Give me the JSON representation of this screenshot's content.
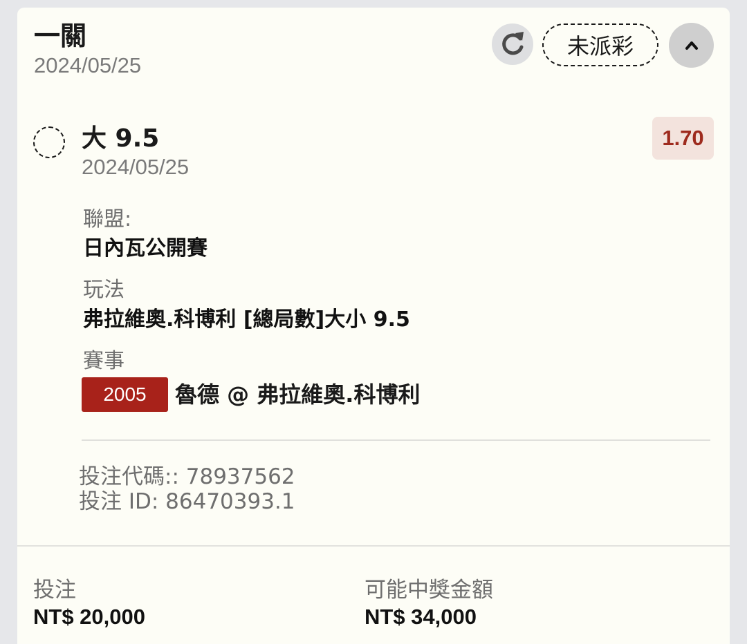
{
  "header": {
    "bet_type": "一關",
    "date": "2024/05/25",
    "status": "未派彩"
  },
  "selection": {
    "name": "大 9.5",
    "date": "2024/05/25",
    "odds": "1.70"
  },
  "details": {
    "league_label": "聯盟:",
    "league_value": "日內瓦公開賽",
    "market_label": "玩法",
    "market_value": "弗拉維奧.科博利 [總局數]大小 9.5",
    "event_label": "賽事",
    "event_id": "2005",
    "event_name": "魯德 @ 弗拉維奧.科博利"
  },
  "codes": {
    "bet_code": "投注代碼:: 78937562",
    "bet_id": "投注 ID: 86470393.1"
  },
  "footer": {
    "stake_label": "投注",
    "stake_value": "NT$ 20,000",
    "payout_label": "可能中獎金額",
    "payout_value": "NT$ 34,000"
  },
  "colors": {
    "accent": "#a8221a",
    "odds_bg": "#f3e3dd",
    "card_bg": "#fdfdf6"
  },
  "icons": [
    "refresh-icon",
    "chevron-up-icon"
  ]
}
